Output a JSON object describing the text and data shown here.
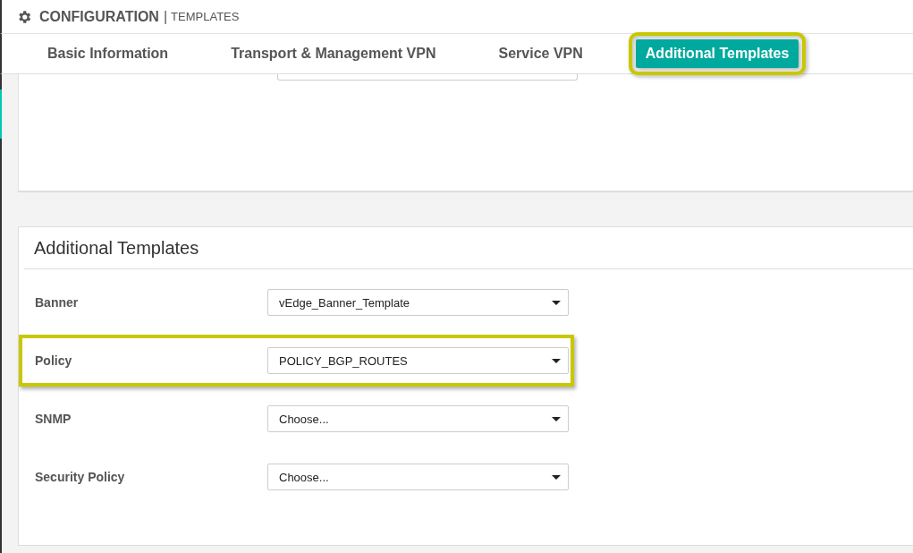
{
  "header": {
    "title": "CONFIGURATION",
    "separator": "|",
    "subtitle": "TEMPLATES"
  },
  "tabs": [
    {
      "label": "Basic Information",
      "selected": false,
      "highlighted": false
    },
    {
      "label": "Transport & Management VPN",
      "selected": false,
      "highlighted": false
    },
    {
      "label": "Service VPN",
      "selected": false,
      "highlighted": false
    },
    {
      "label": "Additional Templates",
      "selected": true,
      "highlighted": true
    }
  ],
  "section": {
    "title": "Additional Templates",
    "fields": [
      {
        "label": "Banner",
        "value": "vEdge_Banner_Template",
        "highlighted": false
      },
      {
        "label": "Policy",
        "value": "POLICY_BGP_ROUTES",
        "highlighted": true
      },
      {
        "label": "SNMP",
        "value": "Choose...",
        "highlighted": false
      },
      {
        "label": "Security Policy",
        "value": "Choose...",
        "highlighted": false
      }
    ]
  }
}
